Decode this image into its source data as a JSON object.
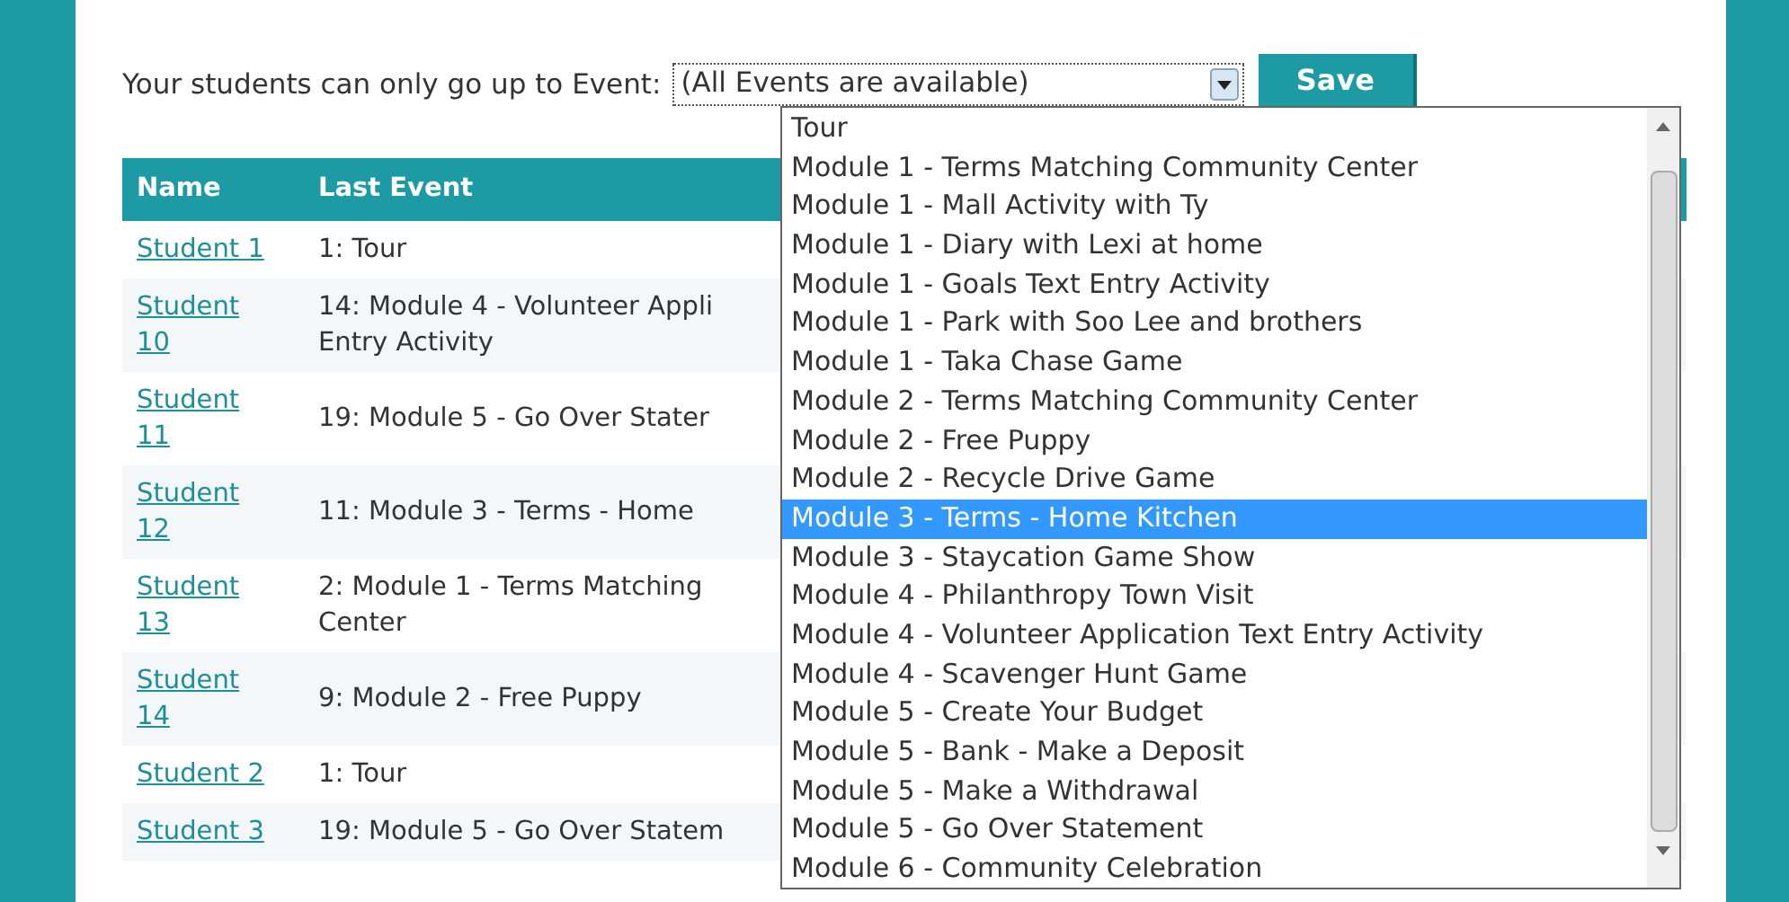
{
  "event_limit": {
    "label": "Your students can only go up to Event:",
    "value": "(All Events are available)",
    "save_button": "Save"
  },
  "table": {
    "columns": [
      "Name",
      "Last Event"
    ],
    "rows": [
      {
        "name": "Student 1",
        "last_event": [
          "1: Tour"
        ]
      },
      {
        "name": "Student 10",
        "last_event": [
          "14: Module 4 - Volunteer Appli",
          "Entry Activity"
        ]
      },
      {
        "name": "Student 11",
        "last_event": [
          "19: Module 5 - Go Over Stater"
        ]
      },
      {
        "name": "Student 12",
        "last_event": [
          "11: Module 3 - Terms - Home"
        ]
      },
      {
        "name": "Student 13",
        "last_event": [
          "2: Module 1 - Terms Matching",
          "Center"
        ]
      },
      {
        "name": "Student 14",
        "last_event": [
          "9: Module 2 - Free Puppy"
        ]
      },
      {
        "name": "Student 2",
        "last_event": [
          "1: Tour"
        ]
      },
      {
        "name": "Student 3",
        "last_event": [
          "19: Module 5 - Go Over Statem"
        ]
      }
    ]
  },
  "dropdown": {
    "options": [
      {
        "label": "Tour",
        "selected": false
      },
      {
        "label": "Module 1 - Terms Matching Community Center",
        "selected": false
      },
      {
        "label": "Module 1 - Mall Activity with Ty",
        "selected": false
      },
      {
        "label": "Module 1 - Diary with Lexi at home",
        "selected": false
      },
      {
        "label": "Module 1 - Goals Text Entry Activity",
        "selected": false
      },
      {
        "label": "Module 1 - Park with Soo Lee and brothers",
        "selected": false
      },
      {
        "label": "Module 1 - Taka Chase Game",
        "selected": false
      },
      {
        "label": "Module 2 - Terms Matching Community Center",
        "selected": false
      },
      {
        "label": "Module 2 - Free Puppy",
        "selected": false
      },
      {
        "label": "Module 2 - Recycle Drive Game",
        "selected": false
      },
      {
        "label": "Module 3 - Terms - Home Kitchen",
        "selected": true
      },
      {
        "label": "Module 3 - Staycation Game Show",
        "selected": false
      },
      {
        "label": "Module 4 - Philanthropy Town Visit",
        "selected": false
      },
      {
        "label": "Module 4 - Volunteer Application Text Entry Activity",
        "selected": false
      },
      {
        "label": "Module 4 - Scavenger Hunt Game",
        "selected": false
      },
      {
        "label": "Module 5 - Create Your Budget",
        "selected": false
      },
      {
        "label": "Module 5 - Bank - Make a Deposit",
        "selected": false
      },
      {
        "label": "Module 5 - Make a Withdrawal",
        "selected": false
      },
      {
        "label": "Module 5 - Go Over Statement",
        "selected": false
      },
      {
        "label": "Module 6 - Community Celebration",
        "selected": false
      }
    ]
  }
}
